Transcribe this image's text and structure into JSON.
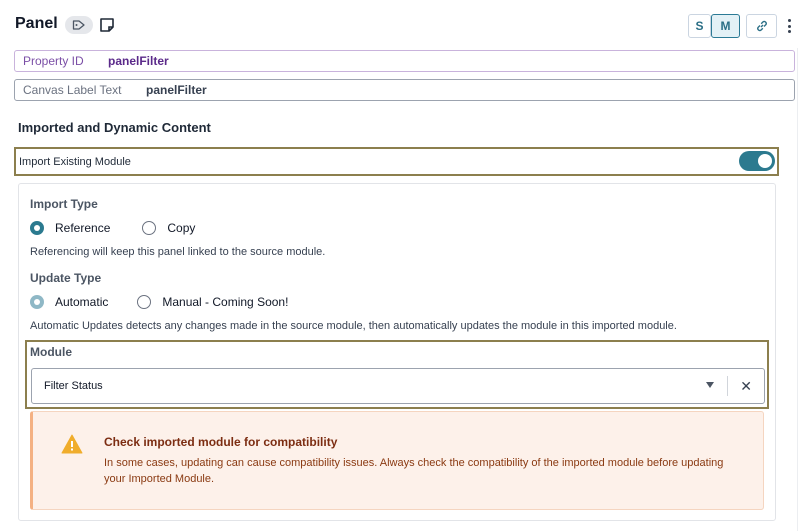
{
  "header": {
    "title": "Panel",
    "icons": {
      "tag": "tag-icon",
      "note": "note-icon",
      "link": "link-icon",
      "more": "more-vertical-icon"
    },
    "size_s_label": "S",
    "size_m_label": "M"
  },
  "fields": {
    "property_id": {
      "label": "Property ID",
      "value": "panelFilter"
    },
    "canvas_label": {
      "label": "Canvas Label Text",
      "value": "panelFilter"
    }
  },
  "section": {
    "title": "Imported and Dynamic Content",
    "toggle_label": "Import Existing Module",
    "toggle_on": true
  },
  "import_type": {
    "title": "Import Type",
    "options": [
      "Reference",
      "Copy"
    ],
    "selected": "Reference",
    "help": "Referencing will keep this panel linked to the source module."
  },
  "update_type": {
    "title": "Update Type",
    "options": [
      "Automatic",
      "Manual - Coming Soon!"
    ],
    "selected": "Automatic",
    "help": "Automatic Updates detects any changes made in the source module, then automatically updates the module in this imported module."
  },
  "module": {
    "label": "Module",
    "selected": "Filter Status"
  },
  "alert": {
    "title": "Check imported module for compatibility",
    "body": "In some cases, updating can cause compatibility issues. Always check the compatibility of the imported module before updating your Imported Module.",
    "icon": "warning-icon"
  },
  "colors": {
    "accent": "#2b7a8f",
    "highlight_border": "#8c7f4e",
    "alert_bg": "#fdf1ea",
    "alert_title": "#7c2d12"
  }
}
